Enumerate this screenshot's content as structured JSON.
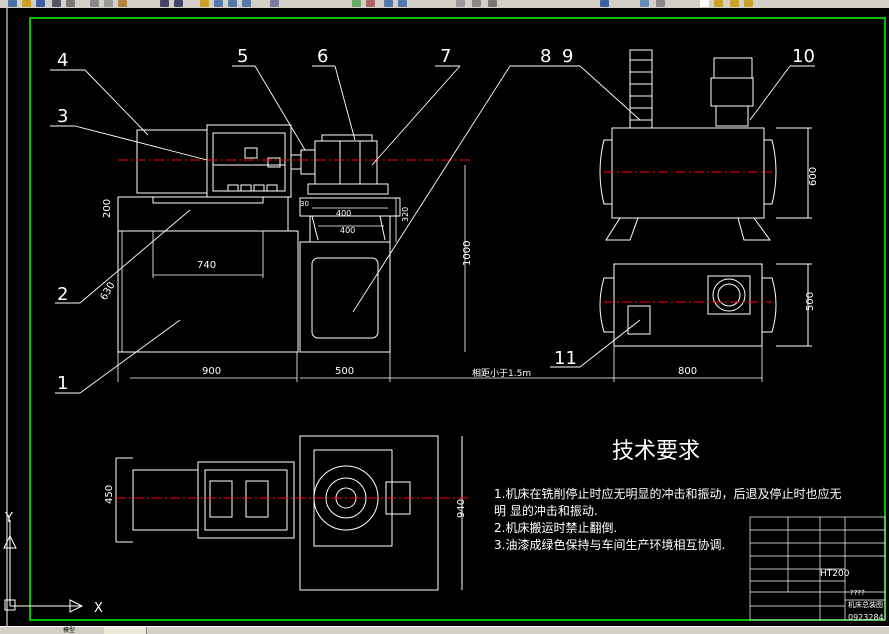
{
  "drawing": {
    "part_labels": [
      "4",
      "5",
      "6",
      "7",
      "8",
      "9",
      "10",
      "3",
      "2",
      "1",
      "11"
    ],
    "dimensions": {
      "d200": "200",
      "d740": "740",
      "d630": "630",
      "d1000": "1000",
      "d900": "900",
      "d500": "500",
      "d400a": "400",
      "d400b": "400",
      "d320": "320",
      "d30": "30",
      "d600": "600",
      "d500r": "500",
      "d800": "800",
      "d450": "450",
      "d940": "940",
      "spacing_note": "相距小于1.5m"
    },
    "tech_requirements": {
      "title": "技术要求",
      "line1": "1.机床在铣削停止时应无明显的冲击和振动，后退及停止时也应无",
      "line2": "明    显的冲击和振动.",
      "line3": "2.机床搬运时禁止翻倒.",
      "line4": "3.油漆成绿色保持与车间生产环境相互协调."
    },
    "title_block": {
      "material": "HT200",
      "question": "????",
      "drawing_no": "0923284",
      "name": "机床总装图"
    },
    "ucs": {
      "x": "X",
      "y": "Y"
    }
  },
  "statusbar": {
    "tab_layout": "模型"
  },
  "colors": {
    "line": "#ffffff",
    "center": "#ff0000",
    "hidden": "#ff0000",
    "border": "#00ff00",
    "background": "#000000"
  }
}
